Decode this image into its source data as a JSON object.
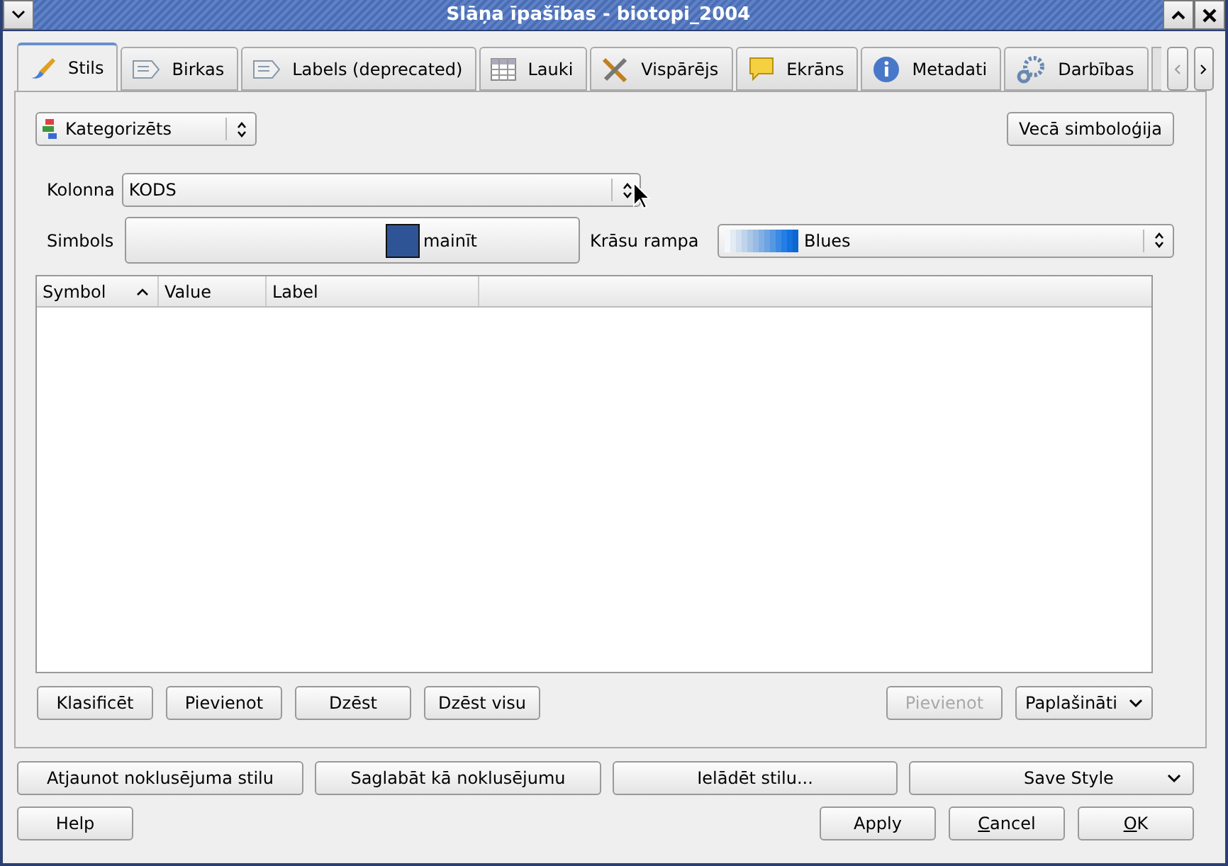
{
  "window": {
    "title": "Slāņa īpašības - biotopi_2004"
  },
  "tabs": [
    {
      "label": "Stils",
      "selected": true
    },
    {
      "label": "Birkas",
      "selected": false
    },
    {
      "label": "Labels (deprecated)",
      "selected": false
    },
    {
      "label": "Lauki",
      "selected": false
    },
    {
      "label": "Vispārējs",
      "selected": false
    },
    {
      "label": "Ekrāns",
      "selected": false
    },
    {
      "label": "Metadati",
      "selected": false
    },
    {
      "label": "Darbības",
      "selected": false
    }
  ],
  "renderer": {
    "value": "Kategorizēts"
  },
  "old_symbology_button": "Vecā simboloģija",
  "column": {
    "label": "Kolonna",
    "value": "KODS"
  },
  "symbol": {
    "label": "Simbols",
    "button": "mainīt",
    "color": "#2f5496"
  },
  "color_ramp": {
    "label": "Krāsu rampa",
    "value": "Blues"
  },
  "table": {
    "columns": [
      {
        "label": "Symbol",
        "sorted": true
      },
      {
        "label": "Value",
        "sorted": false
      },
      {
        "label": "Label",
        "sorted": false
      }
    ]
  },
  "panel_buttons": [
    {
      "label": "Klasificēt",
      "disabled": false
    },
    {
      "label": "Pievienot",
      "disabled": false
    },
    {
      "label": "Dzēst",
      "disabled": false
    },
    {
      "label": "Dzēst visu",
      "disabled": false
    }
  ],
  "panel_buttons_right": [
    {
      "label": "Pievienot",
      "kind": "button",
      "disabled": true
    },
    {
      "label": "Paplašināti",
      "kind": "menu",
      "disabled": false
    }
  ],
  "style_buttons": [
    {
      "label": "Atjaunot noklusējuma stilu",
      "kind": "button"
    },
    {
      "label": "Saglabāt kā noklusējumu",
      "kind": "button"
    },
    {
      "label": "Ielādēt stilu...",
      "kind": "button"
    },
    {
      "label": "Save Style",
      "kind": "menu"
    }
  ],
  "help_button": "Help",
  "dialog_buttons": [
    {
      "label": "Apply",
      "mnemonic": false
    },
    {
      "label": "Cancel",
      "mnemonic": true
    },
    {
      "label": "OK",
      "mnemonic": true
    }
  ]
}
